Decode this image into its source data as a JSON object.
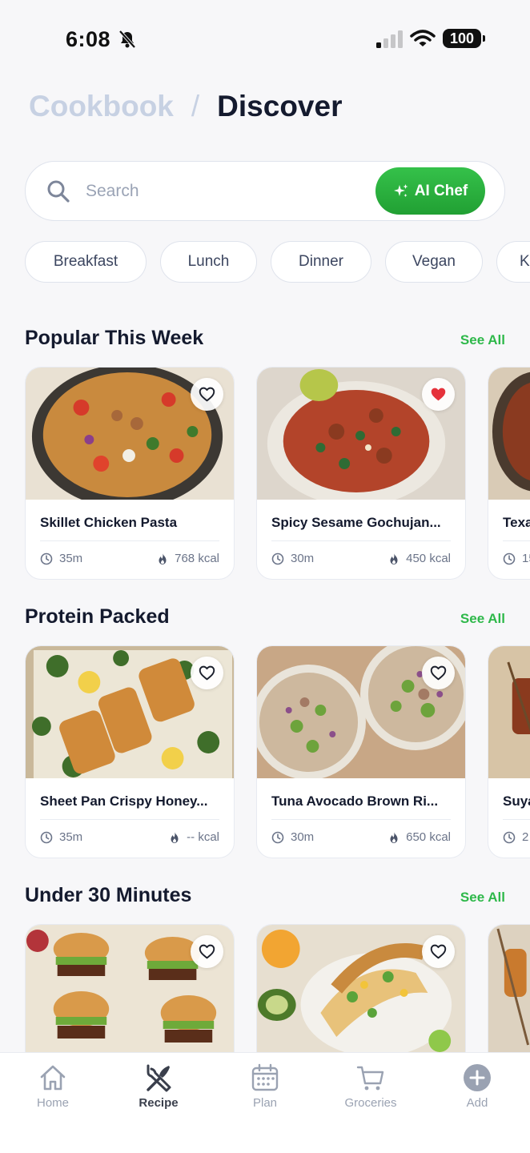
{
  "status": {
    "time": "6:08",
    "battery": "100"
  },
  "header": {
    "parent": "Cookbook",
    "separator": "/",
    "current": "Discover"
  },
  "search": {
    "placeholder": "Search",
    "ai_button": "AI Chef"
  },
  "chips": [
    "Breakfast",
    "Lunch",
    "Dinner",
    "Vegan",
    "K"
  ],
  "sections": [
    {
      "title": "Popular This Week",
      "see_all": "See All",
      "cards": [
        {
          "title": "Skillet Chicken Pasta",
          "time": "35m",
          "kcal": "768 kcal",
          "favorited": false
        },
        {
          "title": "Spicy Sesame Gochujan...",
          "time": "30m",
          "kcal": "450 kcal",
          "favorited": true
        },
        {
          "title": "Texa",
          "time": "15",
          "kcal": "",
          "favorited": false
        }
      ]
    },
    {
      "title": "Protein Packed",
      "see_all": "See All",
      "cards": [
        {
          "title": "Sheet Pan Crispy Honey...",
          "time": "35m",
          "kcal": "-- kcal",
          "favorited": false
        },
        {
          "title": "Tuna Avocado Brown Ri...",
          "time": "30m",
          "kcal": "650 kcal",
          "favorited": false
        },
        {
          "title": "Suya",
          "time": "2",
          "kcal": "",
          "favorited": false
        }
      ]
    },
    {
      "title": "Under 30 Minutes",
      "see_all": "See All",
      "cards": [
        {
          "title": "",
          "time": "",
          "kcal": "",
          "favorited": false
        },
        {
          "title": "",
          "time": "",
          "kcal": "",
          "favorited": false
        },
        {
          "title": "",
          "time": "",
          "kcal": "",
          "favorited": false
        }
      ]
    }
  ],
  "nav": [
    {
      "label": "Home",
      "icon": "home-icon",
      "active": false
    },
    {
      "label": "Recipe",
      "icon": "utensils-icon",
      "active": true
    },
    {
      "label": "Plan",
      "icon": "calendar-icon",
      "active": false
    },
    {
      "label": "Groceries",
      "icon": "cart-icon",
      "active": false
    },
    {
      "label": "Add",
      "icon": "plus-circle-icon",
      "active": false
    }
  ],
  "colors": {
    "accent_green": "#2eb84a",
    "title": "#141a2e",
    "muted": "#c7d1e3",
    "heart_red": "#e5323b"
  }
}
